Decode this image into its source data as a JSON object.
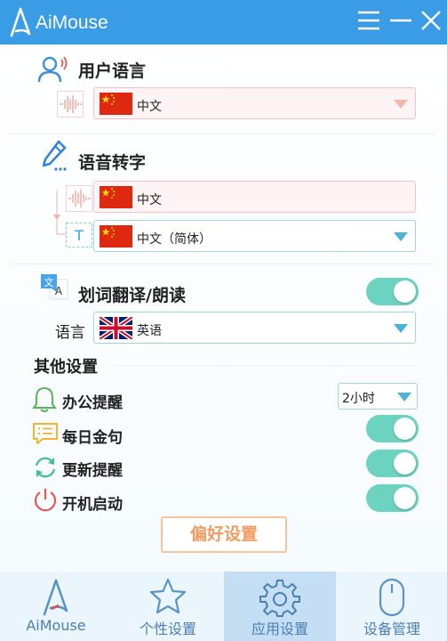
{
  "app": {
    "title": "AiMouse"
  },
  "user_language": {
    "heading": "用户语言",
    "selected": "中文"
  },
  "speech_to_text": {
    "heading": "语音转字",
    "source": "中文",
    "target": "中文（简体）"
  },
  "word_translate": {
    "heading": "划词翻译/朗读",
    "toggle_on": true,
    "language_label": "语言",
    "language": "英语"
  },
  "other_settings": {
    "heading": "其他设置",
    "office_reminder": {
      "label": "办公提醒",
      "interval": "2小时"
    },
    "daily_quote": {
      "label": "每日金句",
      "on": true
    },
    "update_reminder": {
      "label": "更新提醒",
      "on": true
    },
    "auto_start": {
      "label": "开机启动",
      "on": true
    }
  },
  "preferences_button": "偏好设置",
  "nav": {
    "items": [
      {
        "label": "AiMouse",
        "icon": "aimouse-logo-icon"
      },
      {
        "label": "个性设置",
        "icon": "star-icon"
      },
      {
        "label": "应用设置",
        "icon": "gear-icon",
        "active": true
      },
      {
        "label": "设备管理",
        "icon": "mouse-icon"
      }
    ]
  },
  "colors": {
    "title_bar": "#3b9ce6",
    "toggle_on": "#6cd3c1",
    "accent_orange": "#f19c63",
    "nav_active": "#c4def3"
  }
}
